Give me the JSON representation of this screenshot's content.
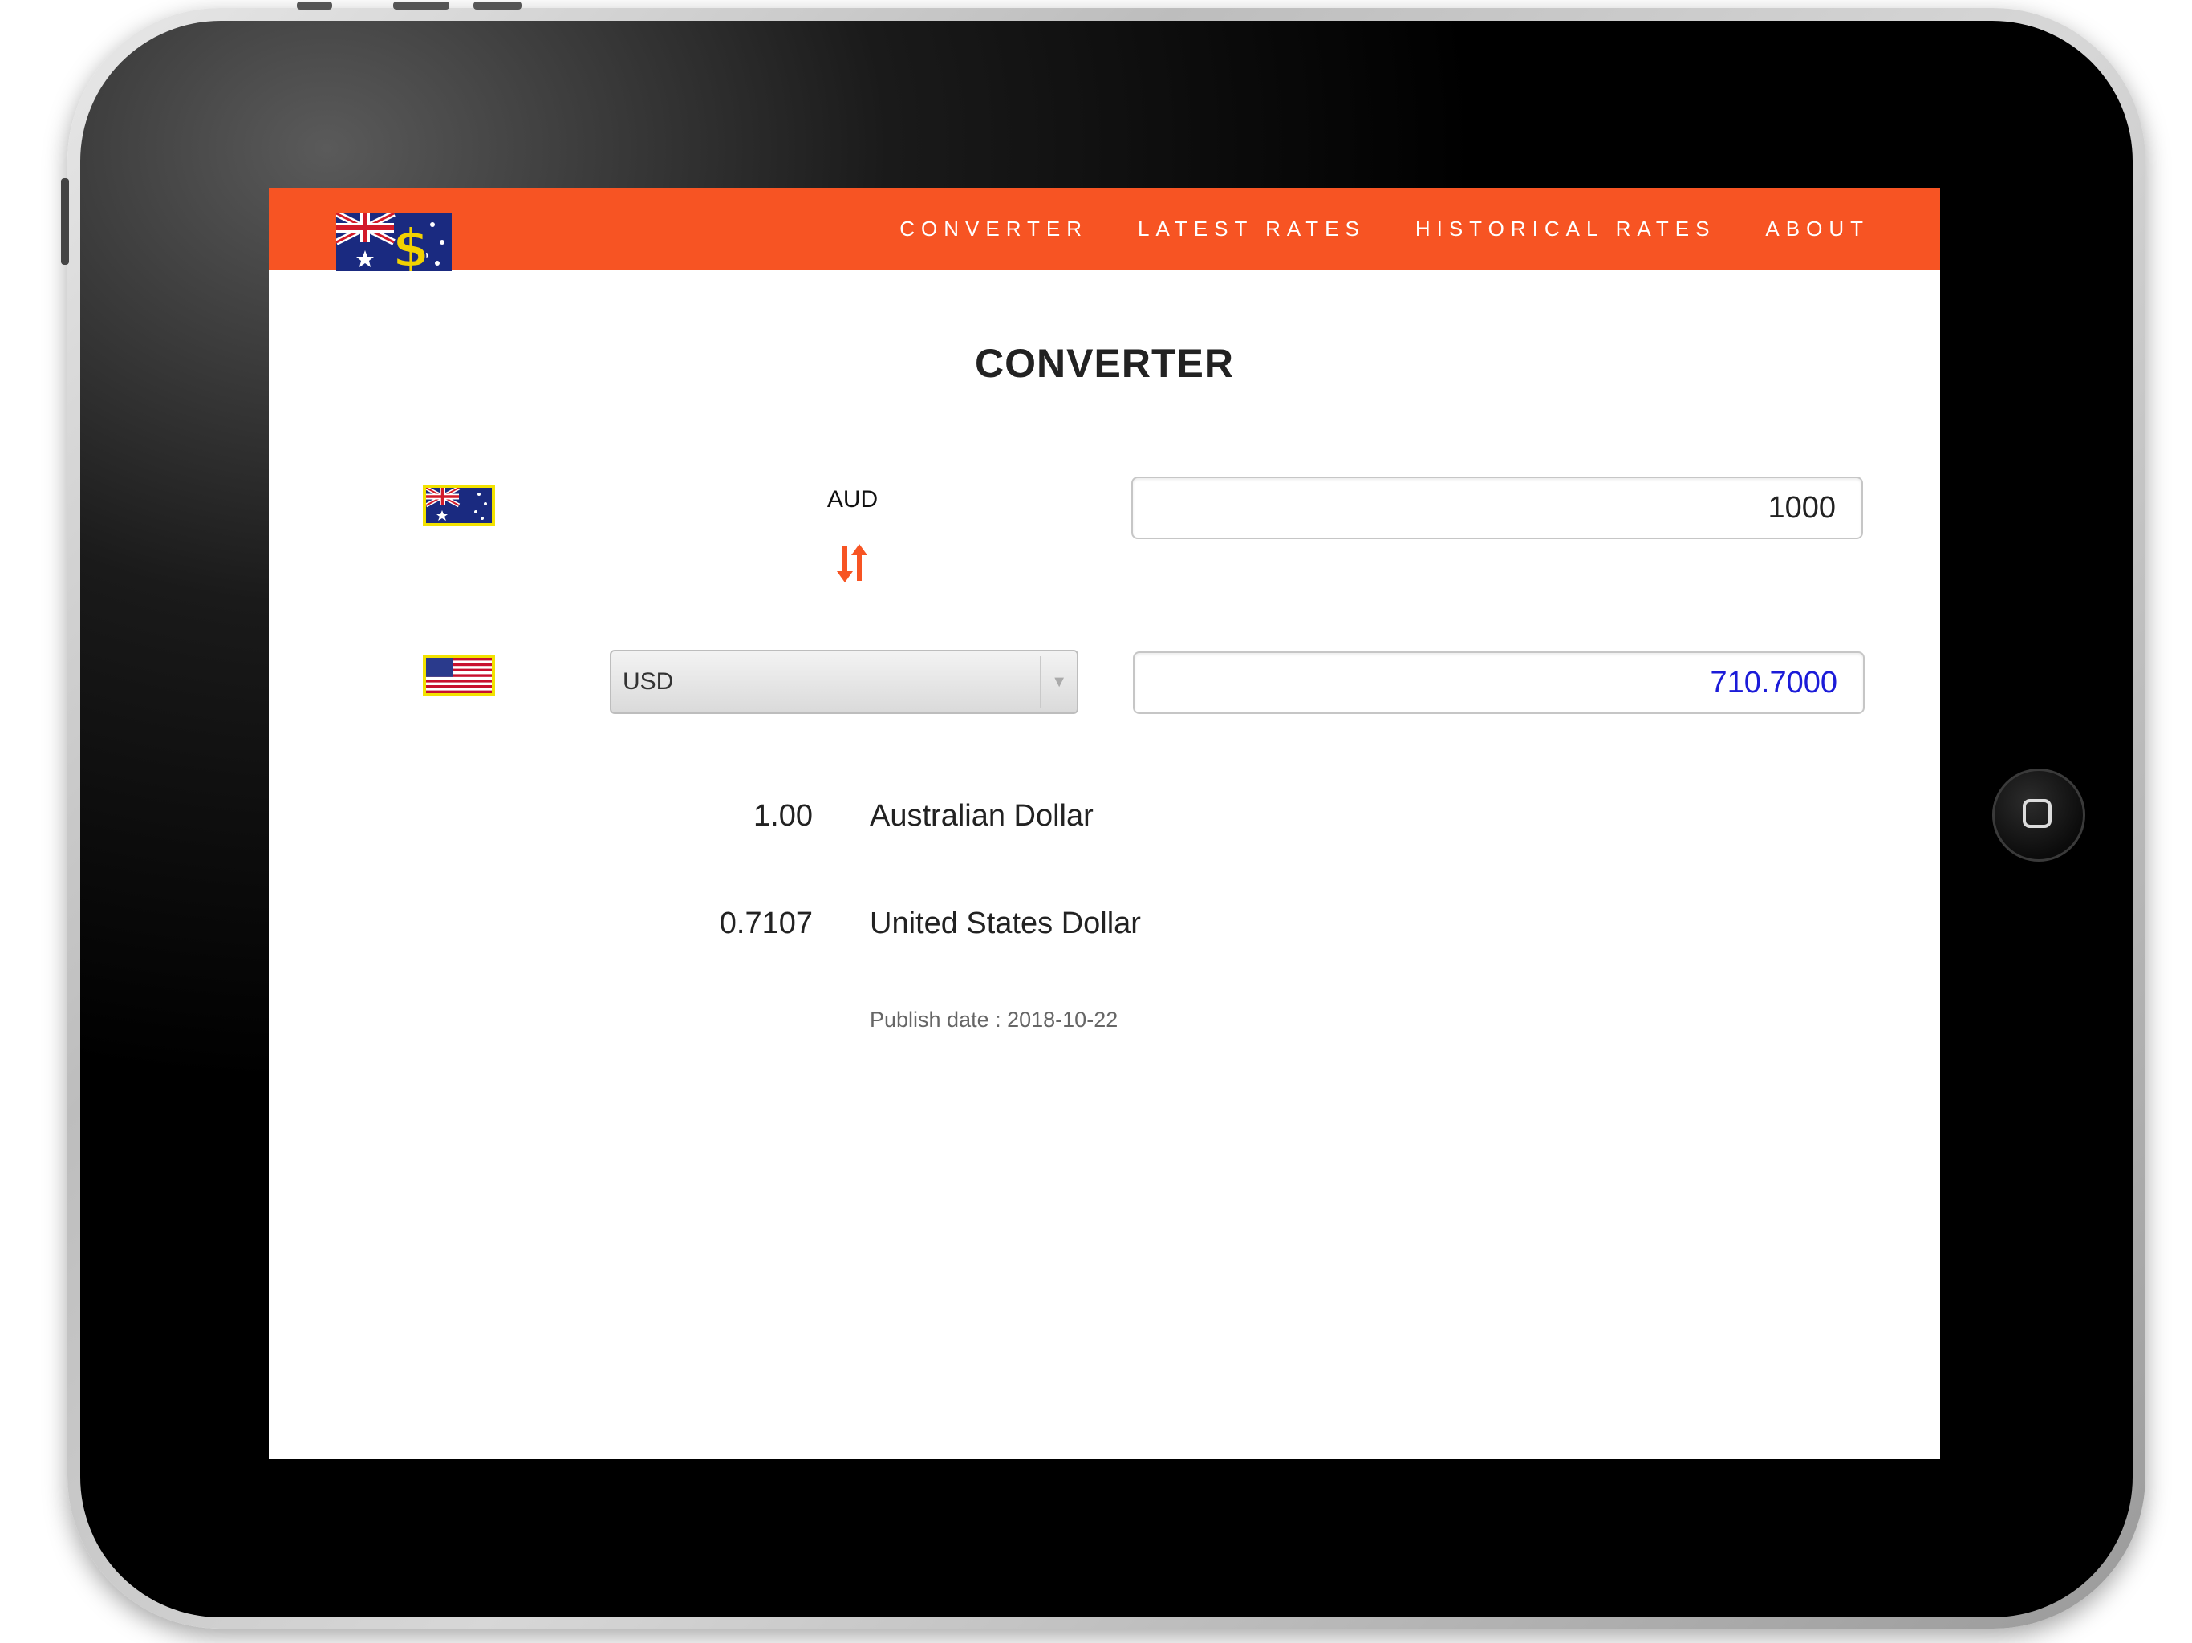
{
  "nav": {
    "items": [
      "CONVERTER",
      "LATEST RATES",
      "HISTORICAL RATES",
      "ABOUT"
    ]
  },
  "page": {
    "title": "CONVERTER"
  },
  "converter": {
    "from_currency": "AUD",
    "from_amount": "1000",
    "to_currency": "USD",
    "to_amount": "710.7000"
  },
  "rates": [
    {
      "value": "1.00",
      "name": "Australian Dollar"
    },
    {
      "value": "0.7107",
      "name": "United States Dollar"
    }
  ],
  "publish_date": "Publish date : 2018-10-22",
  "icons": {
    "logo": "australian-flag-dollar-logo",
    "swap": "swap-arrows-icon",
    "home": "home-button-icon"
  },
  "colors": {
    "navbar": "#f75423",
    "swap_icon": "#f75423",
    "result_text": "#1b1bd8"
  }
}
